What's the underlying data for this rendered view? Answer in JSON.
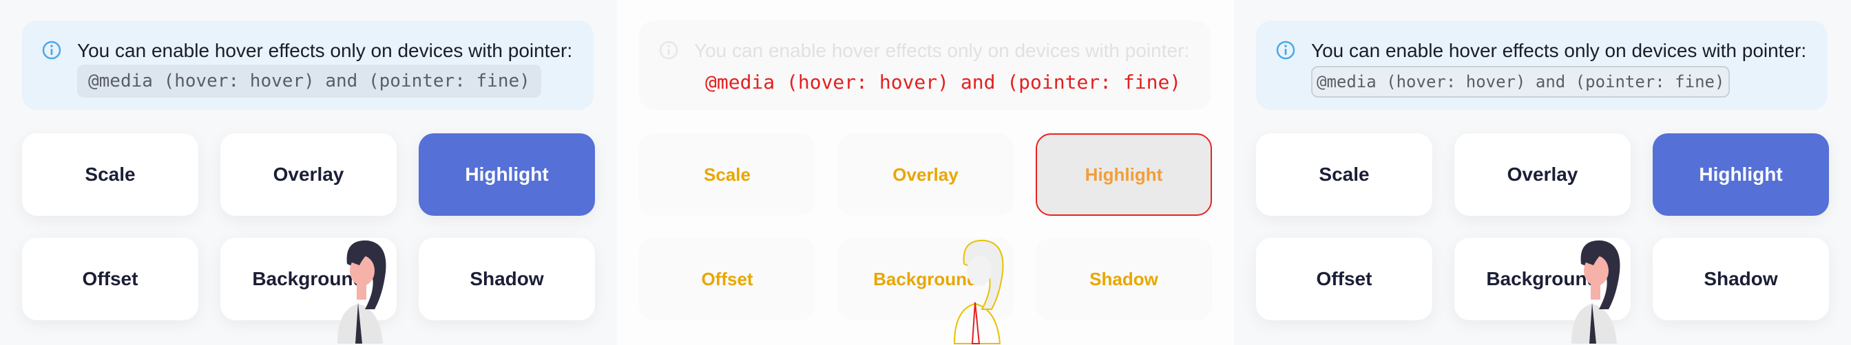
{
  "info": {
    "message": "You can enable hover effects only on devices with pointer:",
    "code": "@media (hover: hover) and (pointer: fine)",
    "icon": "info-icon",
    "accent": "#4aa8e6"
  },
  "buttons": [
    "Scale",
    "Overlay",
    "Highlight",
    "Offset",
    "Background",
    "Shadow"
  ],
  "active_button": "Highlight",
  "colors": {
    "active_bg": "#5570d6",
    "text": "#1b1e36",
    "error_overlay": "#e32020",
    "warning_overlay": "#e9a600"
  }
}
